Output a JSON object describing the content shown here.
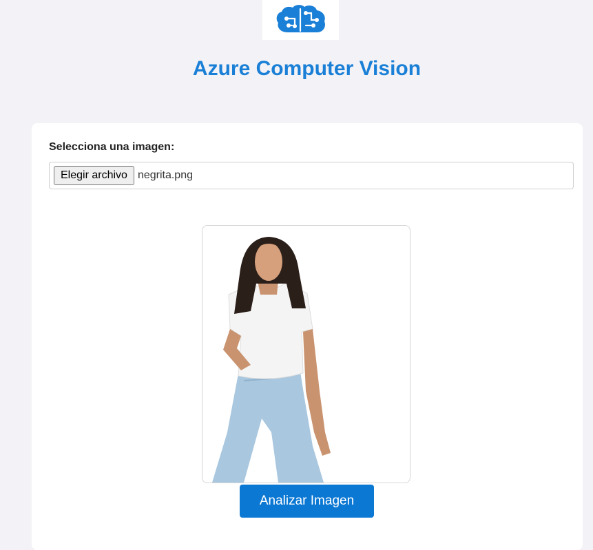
{
  "header": {
    "logo_icon": "azure-brain-circuit-icon",
    "title": "Azure Computer Vision"
  },
  "form": {
    "label": "Selecciona una imagen:",
    "file_button_label": "Elegir archivo",
    "file_name": "negrita.png"
  },
  "preview": {
    "image_alt": "woman-white-tshirt-jeans-photo"
  },
  "actions": {
    "analyze_label": "Analizar Imagen"
  },
  "colors": {
    "accent": "#0b78d4",
    "title": "#1a7fd6",
    "background": "#f3f3f7"
  }
}
